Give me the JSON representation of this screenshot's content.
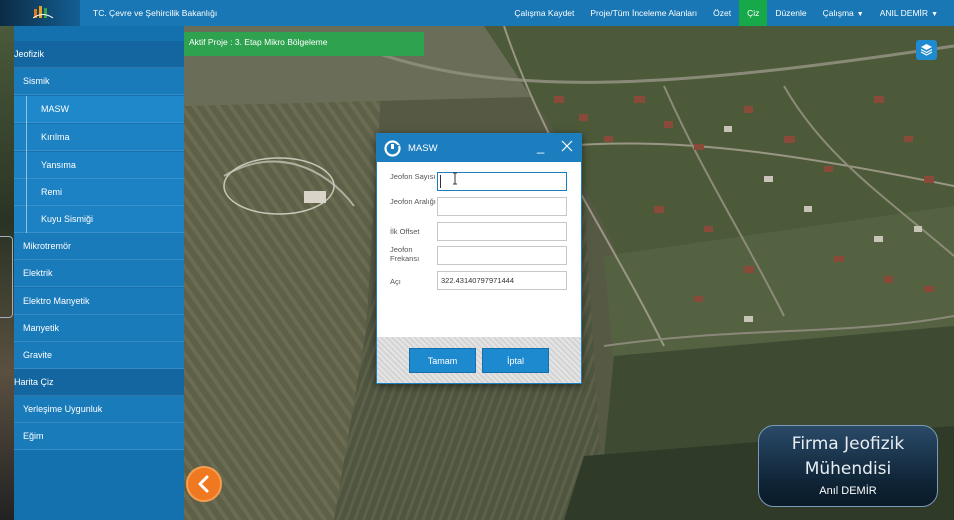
{
  "header": {
    "title": "TC. Çevre ve Şehircilik Bakanlığı",
    "nav": [
      {
        "label": "Çalışma Kaydet"
      },
      {
        "label": "Proje/Tüm İnceleme Alanları"
      },
      {
        "label": "Özet"
      },
      {
        "label": "Çiz",
        "active": true
      },
      {
        "label": "Düzenle"
      },
      {
        "label": "Çalışma",
        "dropdown": true
      },
      {
        "label": "ANIL DEMİR",
        "dropdown": true
      }
    ]
  },
  "sidebar": {
    "items": [
      {
        "label": "Jeofizik",
        "level": 0
      },
      {
        "label": "Sismik",
        "level": 1
      },
      {
        "label": "MASW",
        "level": 2
      },
      {
        "label": "Kırılma",
        "level": 2
      },
      {
        "label": "Yansıma",
        "level": 2
      },
      {
        "label": "Remi",
        "level": 2
      },
      {
        "label": "Kuyu Sismiği",
        "level": 2
      },
      {
        "label": "Mikrotremör",
        "level": 1
      },
      {
        "label": "Elektrik",
        "level": 1
      },
      {
        "label": "Elektro Manyetik",
        "level": 1
      },
      {
        "label": "Manyetik",
        "level": 1
      },
      {
        "label": "Gravite",
        "level": 1
      },
      {
        "label": "Harita Çiz",
        "level": 0
      },
      {
        "label": "Yerleşime Uygunluk",
        "level": 1
      },
      {
        "label": "Eğim",
        "level": 1
      }
    ]
  },
  "map": {
    "project_label": "Aktif Proje : 3. Etap Mikro Bölgeleme"
  },
  "dialog": {
    "title": "MASW",
    "fields": [
      {
        "label": "Jeofon Sayısı",
        "value": ""
      },
      {
        "label": "Jeofon Aralığı",
        "value": ""
      },
      {
        "label": "İlk Offset",
        "value": ""
      },
      {
        "label": "Jeofon Frekansı",
        "value": ""
      },
      {
        "label": "Açı",
        "value": "322.43140797971444"
      }
    ],
    "ok_label": "Tamam",
    "cancel_label": "İptal"
  },
  "badge": {
    "line1": "Firma Jeofizik",
    "line2": "Mühendisi",
    "line3": "Anıl DEMİR"
  },
  "colors": {
    "primary": "#1877b4",
    "active_nav": "#17a84a",
    "back_button": "#f07820"
  }
}
